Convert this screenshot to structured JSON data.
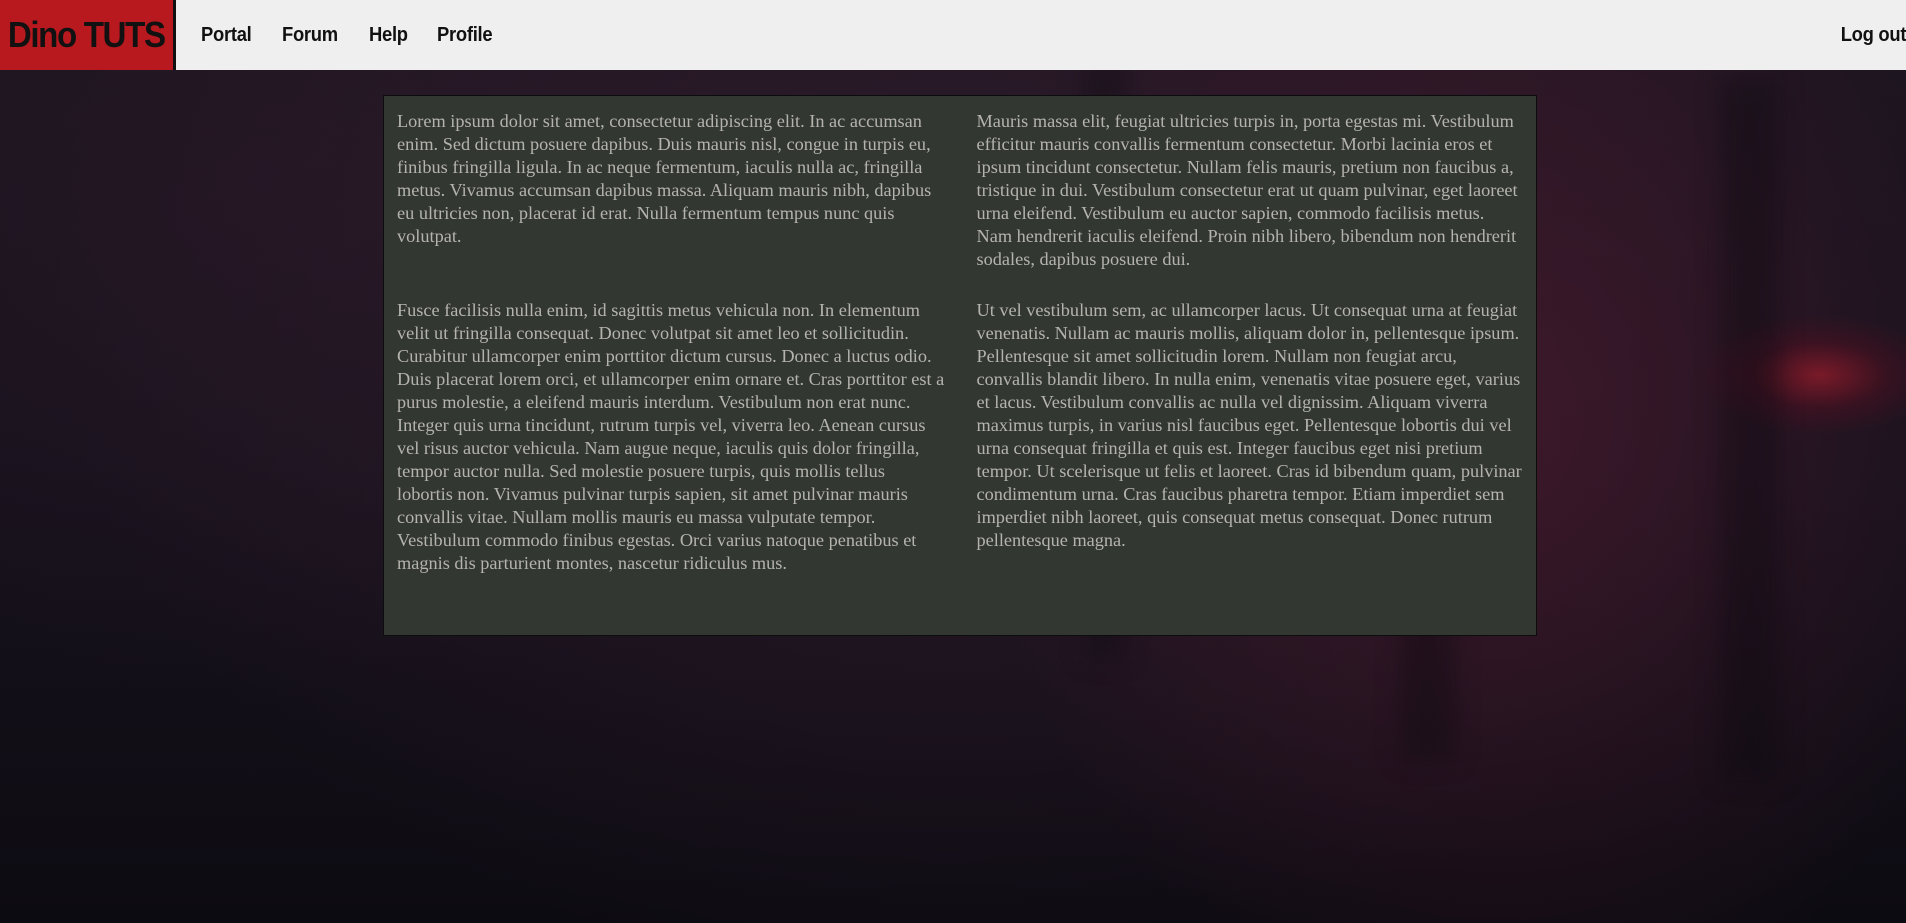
{
  "header": {
    "logo": "Dino TUTS",
    "nav": [
      {
        "label": "Portal"
      },
      {
        "label": "Forum"
      },
      {
        "label": "Help"
      },
      {
        "label": "Profile"
      }
    ],
    "logout": "Log out"
  },
  "content": {
    "paragraphs": [
      "Lorem ipsum dolor sit amet, consectetur adipiscing elit. In ac accumsan enim. Sed dictum posuere dapibus. Duis mauris nisl, congue in turpis eu, finibus fringilla ligula. In ac neque fermentum, iaculis nulla ac, fringilla metus. Vivamus accumsan dapibus massa. Aliquam mauris nibh, dapibus eu ultricies non, placerat id erat. Nulla fermentum tempus nunc quis volutpat.",
      "Mauris massa elit, feugiat ultricies turpis in, porta egestas mi. Vestibulum efficitur mauris convallis fermentum consectetur. Morbi lacinia eros et ipsum tincidunt consectetur. Nullam felis mauris, pretium non faucibus a, tristique in dui. Vestibulum consectetur erat ut quam pulvinar, eget laoreet urna eleifend. Vestibulum eu auctor sapien, commodo facilisis metus. Nam hendrerit iaculis eleifend. Proin nibh libero, bibendum non hendrerit sodales, dapibus posuere dui.",
      "Fusce facilisis nulla enim, id sagittis metus vehicula non. In elementum velit ut fringilla consequat. Donec volutpat sit amet leo et sollicitudin. Curabitur ullamcorper enim porttitor dictum cursus. Donec a luctus odio. Duis placerat lorem orci, et ullamcorper enim ornare et. Cras porttitor est a purus molestie, a eleifend mauris interdum. Vestibulum non erat nunc. Integer quis urna tincidunt, rutrum turpis vel, viverra leo. Aenean cursus vel risus auctor vehicula. Nam augue neque, iaculis quis dolor fringilla, tempor auctor nulla. Sed molestie posuere turpis, quis mollis tellus lobortis non. Vivamus pulvinar turpis sapien, sit amet pulvinar mauris convallis vitae. Nullam mollis mauris eu massa vulputate tempor. Vestibulum commodo finibus egestas. Orci varius natoque penatibus et magnis dis parturient montes, nascetur ridiculus mus.",
      "Ut vel vestibulum sem, ac ullamcorper lacus. Ut consequat urna at feugiat venenatis. Nullam ac mauris mollis, aliquam dolor in, pellentesque ipsum. Pellentesque sit amet sollicitudin lorem. Nullam non feugiat arcu, convallis blandit libero. In nulla enim, venenatis vitae posuere eget, varius et lacus. Vestibulum convallis ac nulla vel dignissim. Aliquam viverra maximus turpis, in varius nisl faucibus eget. Pellentesque lobortis dui vel urna consequat fringilla et quis est. Integer faucibus eget nisi pretium tempor. Ut scelerisque ut felis et laoreet. Cras id bibendum quam, pulvinar condimentum urna. Cras faucibus pharetra tempor. Etiam imperdiet sem imperdiet nibh laoreet, quis consequat metus consequat. Donec rutrum pellentesque magna."
    ]
  },
  "colors": {
    "logo_bg": "#b8191f",
    "header_bg": "#efefef",
    "panel_bg": "#333732",
    "panel_text": "#b4b4ad",
    "page_bg": "#13101a"
  }
}
